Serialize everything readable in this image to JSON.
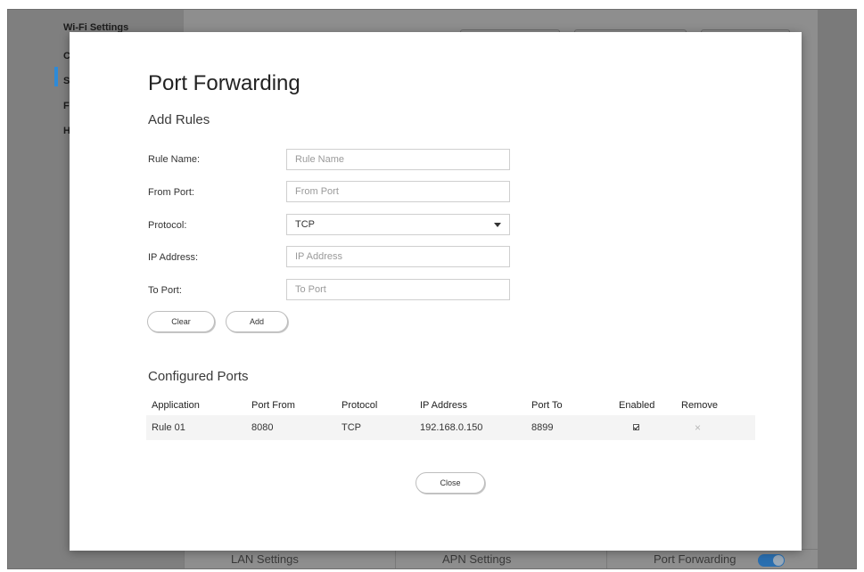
{
  "background": {
    "sidebar_items": [
      "Wi-Fi Settings",
      "C",
      "S",
      "F",
      "H"
    ],
    "bottom_tabs": [
      "LAN Settings",
      "APN Settings",
      "Port Forwarding"
    ]
  },
  "modal": {
    "title": "Port Forwarding",
    "add_rules_title": "Add Rules",
    "fields": {
      "rule_name": {
        "label": "Rule Name:",
        "placeholder": "Rule Name",
        "value": ""
      },
      "from_port": {
        "label": "From Port:",
        "placeholder": "From Port",
        "value": ""
      },
      "protocol": {
        "label": "Protocol:",
        "value": "TCP",
        "icon": "chevron-down-icon"
      },
      "ip_address": {
        "label": "IP Address:",
        "placeholder": "IP Address",
        "value": ""
      },
      "to_port": {
        "label": "To Port:",
        "placeholder": "To Port",
        "value": ""
      }
    },
    "buttons": {
      "clear": "Clear",
      "add": "Add",
      "close": "Close"
    },
    "configured_ports": {
      "title": "Configured Ports",
      "columns": [
        "Application",
        "Port From",
        "Protocol",
        "IP Address",
        "Port To",
        "Enabled",
        "Remove"
      ],
      "rows": [
        {
          "application": "Rule 01",
          "port_from": "8080",
          "protocol": "TCP",
          "ip_address": "192.168.0.150",
          "port_to": "8899",
          "enabled": true
        }
      ]
    }
  },
  "colors": {
    "accent": "#2d8ad8",
    "overlay": "#8e8e8e",
    "row_bg": "#f4f4f4"
  }
}
